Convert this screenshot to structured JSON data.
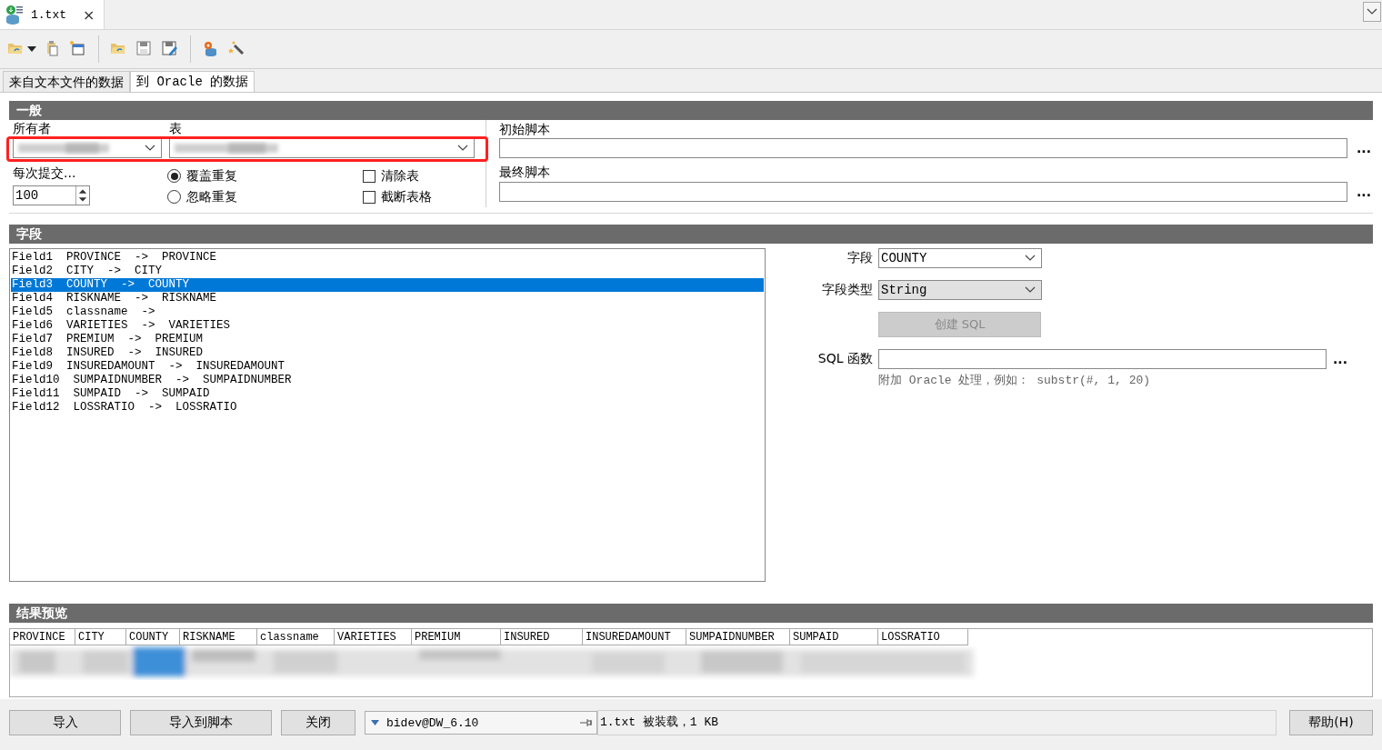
{
  "document_tab": {
    "label": "1.txt",
    "close": "×"
  },
  "page_tabs": [
    {
      "label": "来自文本文件的数据",
      "selected": false
    },
    {
      "label": "到 Oracle 的数据",
      "selected": true
    }
  ],
  "general": {
    "title": "一般",
    "owner_label": "所有者",
    "table_label": "表",
    "commit_label": "每次提交...",
    "commit_value": "100",
    "duplicates": [
      {
        "label": "覆盖重复",
        "selected": true
      },
      {
        "label": "忽略重复",
        "selected": false
      }
    ],
    "options": [
      {
        "label": "清除表",
        "checked": false
      },
      {
        "label": "截断表格",
        "checked": false
      }
    ],
    "initial_script_label": "初始脚本",
    "initial_script_more": "...",
    "final_script_label": "最终脚本",
    "final_script_more": "..."
  },
  "fields": {
    "title": "字段",
    "items": [
      {
        "text": "Field1  PROVINCE  ->  PROVINCE",
        "selected": false
      },
      {
        "text": "Field2  CITY  ->  CITY",
        "selected": false
      },
      {
        "text": "Field3  COUNTY  ->  COUNTY",
        "selected": true
      },
      {
        "text": "Field4  RISKNAME  ->  RISKNAME",
        "selected": false
      },
      {
        "text": "Field5  classname  ->",
        "selected": false
      },
      {
        "text": "Field6  VARIETIES  ->  VARIETIES",
        "selected": false
      },
      {
        "text": "Field7  PREMIUM  ->  PREMIUM",
        "selected": false
      },
      {
        "text": "Field8  INSURED  ->  INSURED",
        "selected": false
      },
      {
        "text": "Field9  INSUREDAMOUNT  ->  INSUREDAMOUNT",
        "selected": false
      },
      {
        "text": "Field10  SUMPAIDNUMBER  ->  SUMPAIDNUMBER",
        "selected": false
      },
      {
        "text": "Field11  SUMPAID  ->  SUMPAID",
        "selected": false
      },
      {
        "text": "Field12  LOSSRATIO  ->  LOSSRATIO",
        "selected": false
      }
    ],
    "field_label": "字段",
    "field_value": "COUNTY",
    "type_label": "字段类型",
    "type_value": "String",
    "create_sql": {
      "label": "创建 SQL",
      "disabled": true
    },
    "sql_label": "SQL 函数",
    "sql_more": "...",
    "hint": "附加 Oracle 处理，例如： substr(#, 1, 20)"
  },
  "preview": {
    "title": "结果预览",
    "columns": [
      "PROVINCE",
      "CITY",
      "COUNTY",
      "RISKNAME",
      "classname",
      "VARIETIES",
      "PREMIUM",
      "INSURED",
      "INSUREDAMOUNT",
      "SUMPAIDNUMBER",
      "SUMPAID",
      "LOSSRATIO"
    ]
  },
  "bottom": {
    "buttons": [
      "导入",
      "导入到脚本",
      "关闭"
    ],
    "connection": "bidev@DW_6.10",
    "status": "1.txt 被装载，1 KB",
    "help": "帮助(H)"
  }
}
